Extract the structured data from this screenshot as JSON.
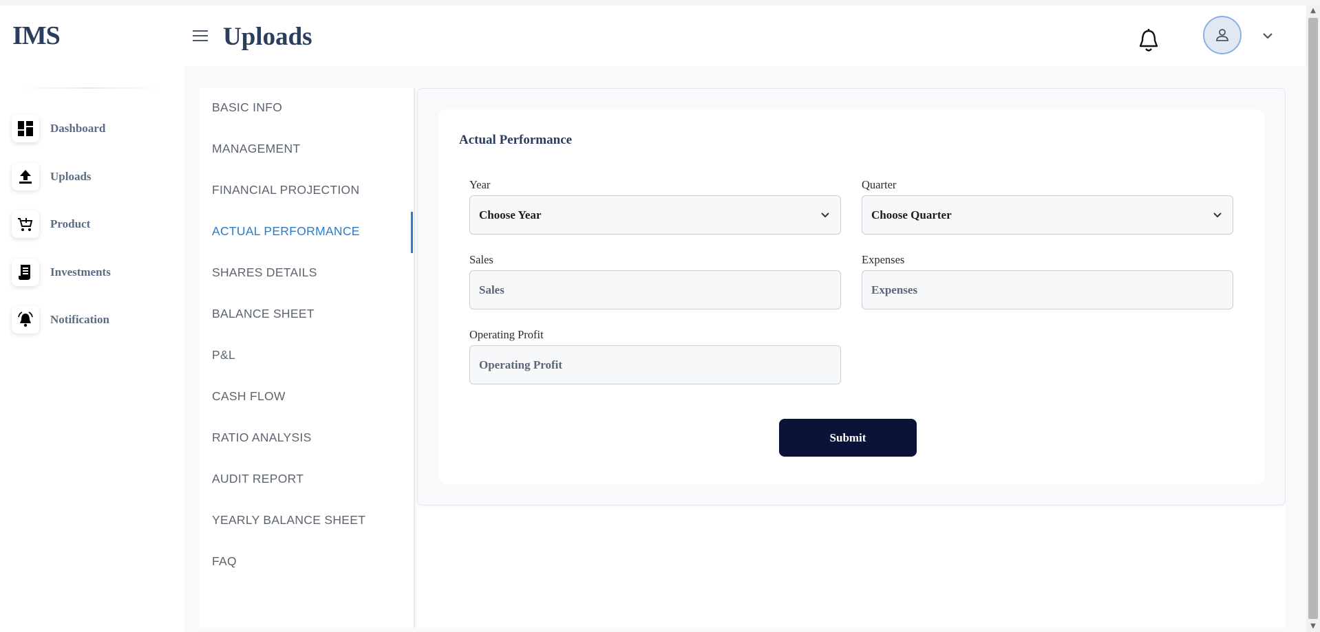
{
  "app": {
    "logo": "IMS"
  },
  "header": {
    "title": "Uploads"
  },
  "sidebar": {
    "items": [
      {
        "label": "Dashboard",
        "icon": "dashboard-icon"
      },
      {
        "label": "Uploads",
        "icon": "upload-icon"
      },
      {
        "label": "Product",
        "icon": "cart-icon"
      },
      {
        "label": "Investments",
        "icon": "receipt-icon"
      },
      {
        "label": "Notification",
        "icon": "alarm-icon"
      }
    ]
  },
  "tabs": {
    "items": [
      {
        "label": "BASIC INFO"
      },
      {
        "label": "MANAGEMENT"
      },
      {
        "label": "FINANCIAL PROJECTION"
      },
      {
        "label": "ACTUAL PERFORMANCE",
        "active": true
      },
      {
        "label": "SHARES DETAILS"
      },
      {
        "label": "BALANCE SHEET"
      },
      {
        "label": "P&L"
      },
      {
        "label": "CASH FLOW"
      },
      {
        "label": "RATIO ANALYSIS"
      },
      {
        "label": "AUDIT REPORT"
      },
      {
        "label": "YEARLY BALANCE SHEET"
      },
      {
        "label": "FAQ"
      }
    ]
  },
  "form": {
    "title": "Actual Performance",
    "year": {
      "label": "Year",
      "value": "Choose Year"
    },
    "quarter": {
      "label": "Quarter",
      "value": "Choose Quarter"
    },
    "sales": {
      "label": "Sales",
      "placeholder": "Sales"
    },
    "expenses": {
      "label": "Expenses",
      "placeholder": "Expenses"
    },
    "operating_profit": {
      "label": "Operating Profit",
      "placeholder": "Operating Profit"
    },
    "submit_label": "Submit"
  },
  "colors": {
    "accent": "#2b7bc7",
    "brand_text": "#2a3d5c",
    "submit_bg": "#0b1438"
  }
}
